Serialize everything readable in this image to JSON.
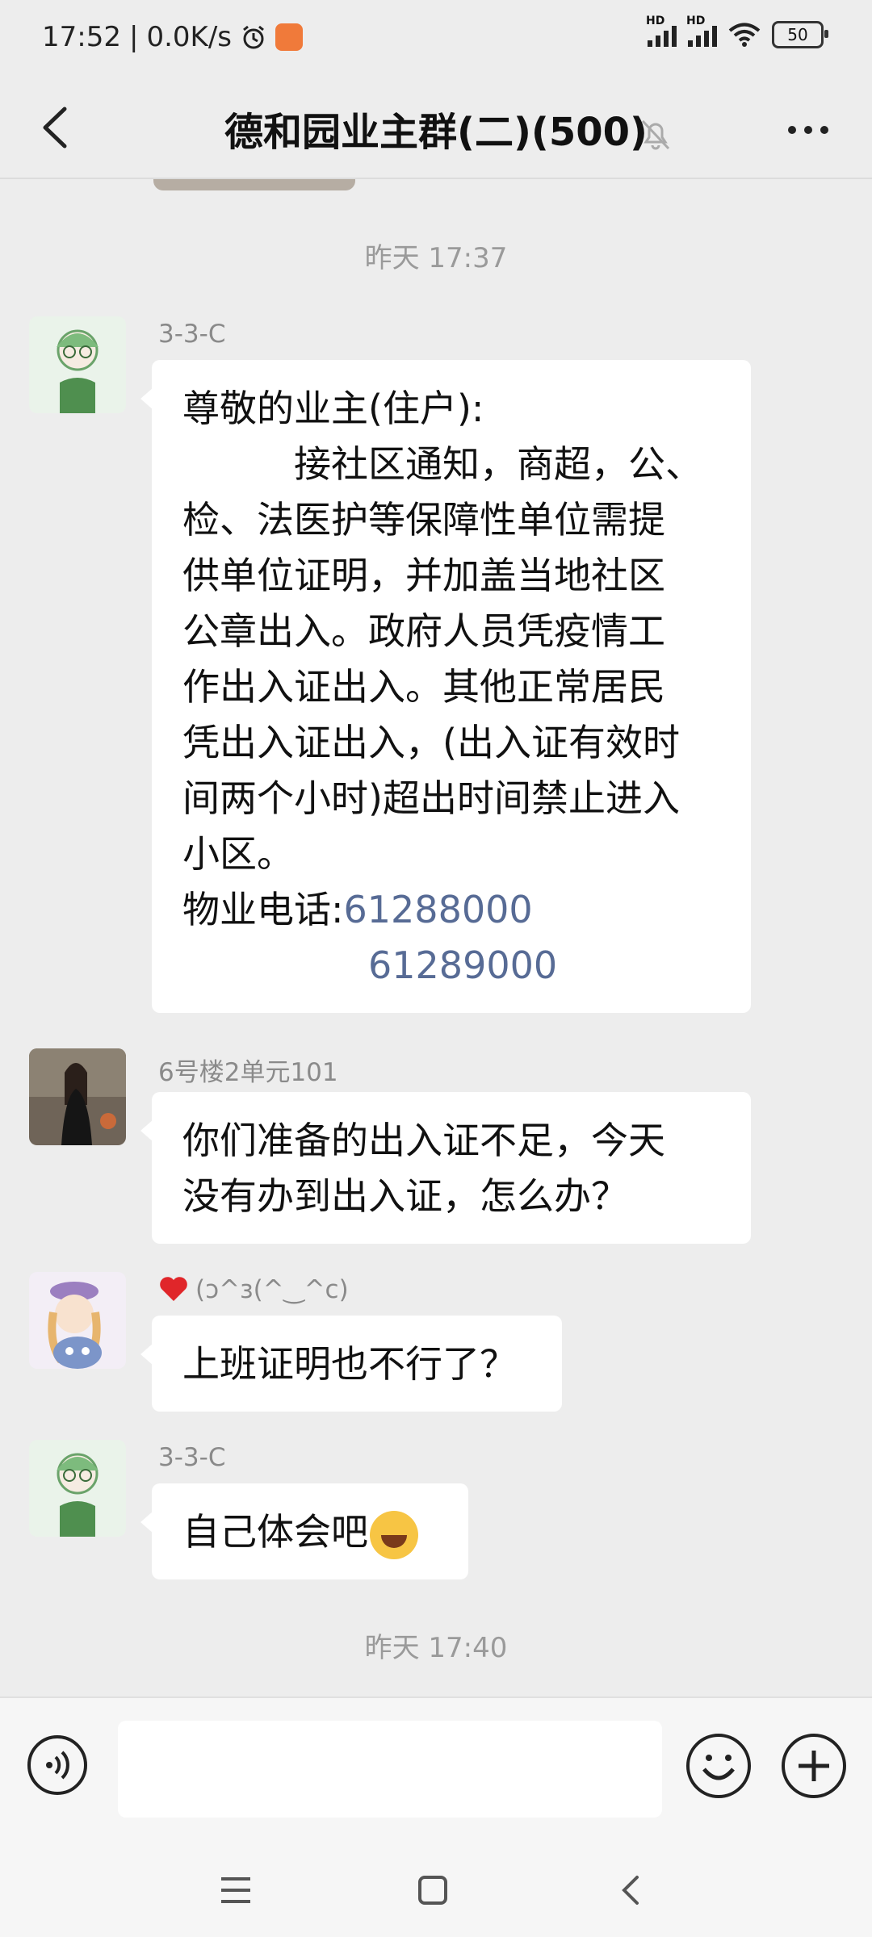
{
  "status_bar": {
    "time": "17:52",
    "network_speed": "0.0K/s",
    "signal_1_label": "HD",
    "signal_2_label": "HD",
    "battery": "50",
    "icons": [
      "alarm-icon",
      "app-notification-icon",
      "signal-icon",
      "wifi-icon",
      "battery-icon"
    ]
  },
  "header": {
    "title": "德和园业主群(二)(500)",
    "icons": [
      "back-icon",
      "mute-icon",
      "more-icon"
    ]
  },
  "chat": {
    "timestamp_1": "昨天 17:37",
    "timestamp_2": "昨天 17:40",
    "messages": [
      {
        "sender": "3-3-C",
        "lines": [
          "尊敬的业主(住户):",
          "　　　接社区通知，商超，公、",
          "检、法医护等保障性单位需提",
          "供单位证明，并加盖当地社区",
          "公章出入。政府人员凭疫情工",
          "作出入证出入。其他正常居民",
          "凭出入证出入，(出入证有效时",
          "间两个小时)超出时间禁止进入",
          "小区。"
        ],
        "phone_label": "物业电话:",
        "phone_1": "61288000",
        "phone_2": "61289000"
      },
      {
        "sender": "6号楼2单元101",
        "lines": [
          "你们准备的出入证不足，今天",
          "没有办到出入证，怎么办？"
        ]
      },
      {
        "sender": "(ɔ^з(^‿^c)",
        "sender_prefix_icon": "heart-icon",
        "lines": [
          "上班证明也不行了？"
        ]
      },
      {
        "sender": "3-3-C",
        "lines": [
          "自己体会吧"
        ],
        "trailing_icon": "crying-laughing-emoji-icon"
      }
    ]
  },
  "input_bar": {
    "placeholder": "",
    "icons": [
      "voice-icon",
      "emoji-icon",
      "plus-icon"
    ]
  },
  "system_nav": {
    "icons": [
      "menu-icon",
      "home-icon",
      "back-nav-icon"
    ]
  }
}
